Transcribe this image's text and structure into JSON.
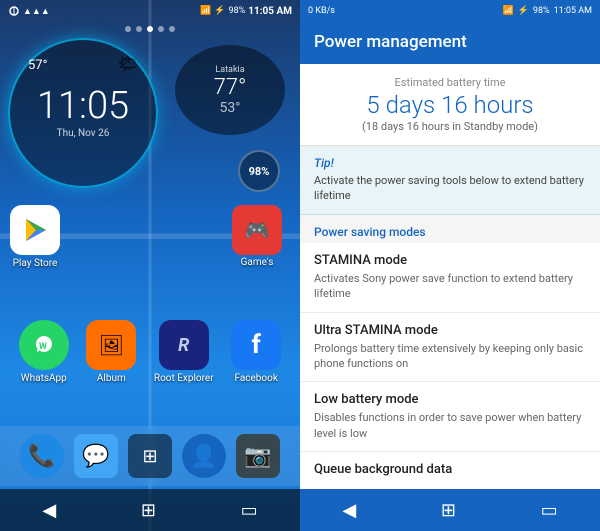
{
  "left": {
    "status": {
      "time": "11:05 AM",
      "battery": "98%",
      "battery_icon": "🔋"
    },
    "dots": [
      false,
      false,
      true,
      false,
      false
    ],
    "clock": {
      "temp": "57°",
      "time": "11:05",
      "date": "Thu, Nov 26",
      "weather": "🌤"
    },
    "weather": {
      "city": "Latakia",
      "temp_high": "77°",
      "temp_low": "53°"
    },
    "battery_badge": "98%",
    "apps": [
      {
        "label": "Play Store",
        "icon": "▶",
        "color": "#fff"
      },
      {
        "label": "",
        "icon": "",
        "color": "transparent"
      },
      {
        "label": "",
        "icon": "",
        "color": "transparent"
      },
      {
        "label": "Game's",
        "icon": "🎮",
        "color": "#e53935"
      }
    ],
    "bottom_apps": [
      {
        "label": "WhatsApp",
        "icon": "📱",
        "color": "#25D366"
      },
      {
        "label": "Album",
        "icon": "📷",
        "color": "#FF6F00"
      },
      {
        "label": "Root Explorer",
        "icon": "R",
        "color": "#1a237e"
      },
      {
        "label": "Facebook",
        "icon": "f",
        "color": "#1877F2"
      }
    ],
    "dock": [
      {
        "icon": "📞",
        "label": "phone"
      },
      {
        "icon": "💬",
        "label": "messages"
      },
      {
        "icon": "⊞",
        "label": "apps"
      },
      {
        "icon": "👤",
        "label": "contacts"
      },
      {
        "icon": "📷",
        "label": "camera"
      }
    ],
    "nav": {
      "back": "◀",
      "home": "⊞",
      "recent": "▭"
    }
  },
  "right": {
    "status": {
      "left_text": "0 KB/s",
      "time": "11:05 AM",
      "battery": "98%"
    },
    "title": "Power management",
    "battery_section": {
      "label": "Estimated battery time",
      "time": "5 days 16 hours",
      "standby": "(18 days 16 hours in Standby mode)"
    },
    "tip": {
      "label": "Tip!",
      "text": "Activate the power saving tools below to extend battery lifetime"
    },
    "modes_header": "Power saving modes",
    "modes": [
      {
        "title": "STAMINA mode",
        "desc": "Activates Sony power save function to extend battery lifetime"
      },
      {
        "title": "Ultra STAMINA mode",
        "desc": "Prolongs battery time extensively by keeping only basic phone functions on"
      },
      {
        "title": "Low battery mode",
        "desc": "Disables functions in order to save power when battery level is low"
      },
      {
        "title": "Queue background data",
        "desc": ""
      }
    ],
    "nav": {
      "back": "◀",
      "home": "⊞",
      "recent": "▭"
    }
  }
}
